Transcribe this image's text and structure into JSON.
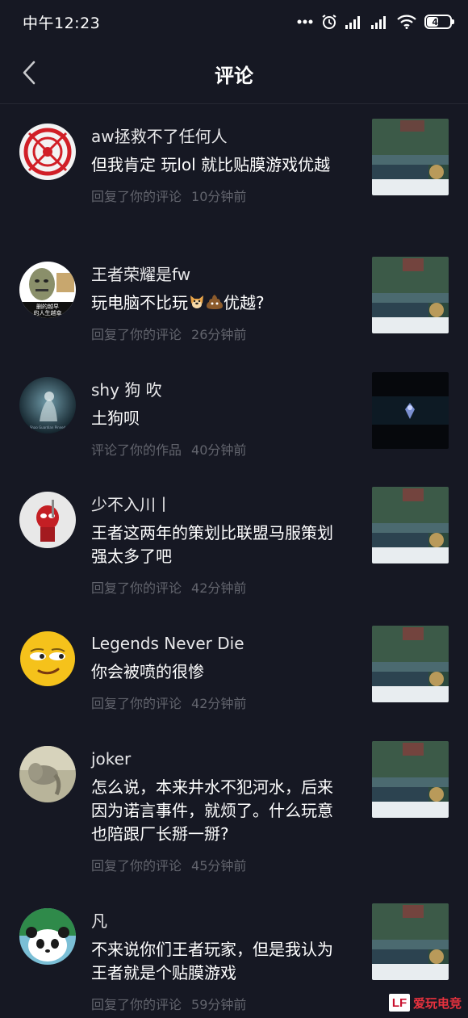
{
  "status_bar": {
    "time": "中午12:23",
    "battery": "47"
  },
  "header": {
    "title": "评论"
  },
  "notifications": [
    {
      "username": "aw拯救不了任何人",
      "comment": "但我肯定 玩lol 就比贴膜游戏优越",
      "action": "回复了你的评论",
      "time": "10分钟前",
      "avatar_icon": "red-circle-avatar",
      "thumb_icon": "game-screenshot"
    },
    {
      "username": "王者荣耀是fw",
      "comment_before": "玩电脑不比玩",
      "comment_after": "优越?",
      "action": "回复了你的评论",
      "time": "26分钟前",
      "avatar_caption_1": "删的越早",
      "avatar_caption_2": "的人生越幸",
      "avatar_icon": "meme-face-avatar",
      "thumb_icon": "game-screenshot"
    },
    {
      "username": "shy 狗 吹",
      "comment": "土狗呗",
      "action": "评论了你的作品",
      "time": "40分钟前",
      "avatar_caption": "Shao Guardian Pinned",
      "avatar_icon": "dark-art-avatar",
      "thumb_icon": "dark-video-thumbnail"
    },
    {
      "username": "少不入川丨",
      "comment": "王者这两年的策划比联盟马服策划强太多了吧",
      "action": "回复了你的评论",
      "time": "42分钟前",
      "avatar_icon": "deadpool-avatar",
      "thumb_icon": "game-screenshot"
    },
    {
      "username": "Legends Never Die",
      "comment": "你会被喷的很惨",
      "action": "回复了你的评论",
      "time": "42分钟前",
      "avatar_icon": "smirk-emoji-avatar",
      "thumb_icon": "game-screenshot"
    },
    {
      "username": "joker",
      "comment": "怎么说，本来井水不犯河水，后来因为诺言事件，就烦了。什么玩意也陪跟厂长掰一掰?",
      "action": "回复了你的评论",
      "time": "45分钟前",
      "avatar_icon": "elephant-avatar",
      "thumb_icon": "game-screenshot"
    },
    {
      "username": "凡",
      "comment": "不来说你们王者玩家，但是我认为王者就是个贴膜游戏",
      "action": "回复了你的评论",
      "time": "59分钟前",
      "avatar_icon": "panda-bear-avatar",
      "thumb_icon": "game-screenshot"
    }
  ],
  "watermark": {
    "badge": "LF",
    "text": "爱玩电竞"
  },
  "colors": {
    "background": "#161823",
    "meta_text": "#62646d",
    "divider": "#262833"
  }
}
